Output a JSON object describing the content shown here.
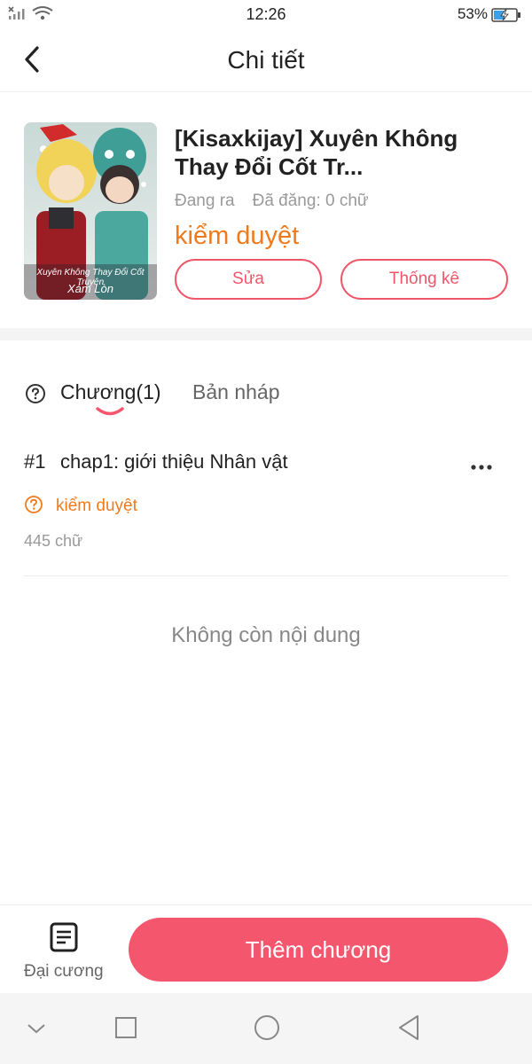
{
  "status_bar": {
    "time": "12:26",
    "battery_percent": "53%",
    "battery_level": 0.53,
    "icons": [
      "signal-icon",
      "wifi-icon",
      "battery-icon"
    ]
  },
  "header": {
    "title": "Chi tiết",
    "back_icon": "chevron-left-icon"
  },
  "book": {
    "title": "[Kisaxkijay] Xuyên Không Thay Đổi Cốt Tr...",
    "state": "Đang ra",
    "posted": "Đã đăng: 0 chữ",
    "review_status": "kiểm duyệt",
    "edit_label": "Sửa",
    "stats_label": "Thống kê",
    "cover_text_line1": "Xuyên Không Thay Đổi Cốt Truyện",
    "cover_text_line2": "Xám Lòn"
  },
  "tabs": {
    "chapters_label": "Chương(1)",
    "drafts_label": "Bản nháp"
  },
  "chapters": [
    {
      "number": "#1",
      "title": "chap1: giới thiệu Nhân vật",
      "status": "kiểm duyệt",
      "words": "445 chữ"
    }
  ],
  "empty_text": "Không còn nội dung",
  "bottom_bar": {
    "outline_label": "Đại cương",
    "add_chapter_label": "Thêm chương"
  },
  "colors": {
    "accent": "#f4566d",
    "review": "#f07a1a",
    "muted": "#9a9a9a"
  }
}
